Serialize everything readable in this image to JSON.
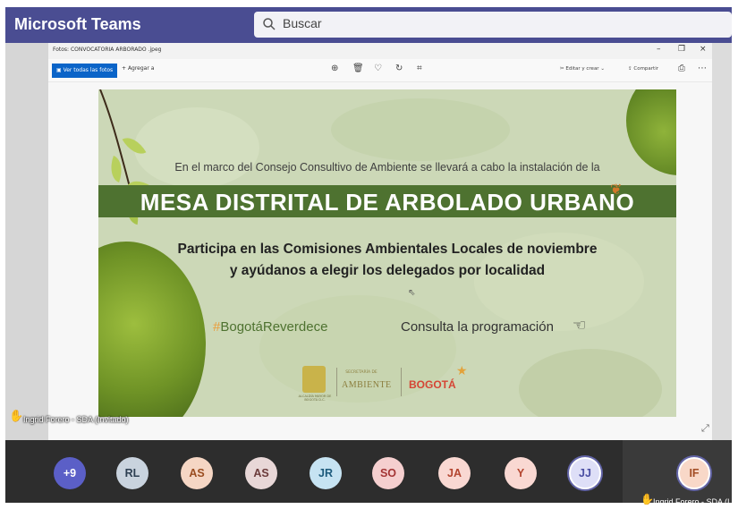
{
  "teams": {
    "app_title": "Microsoft Teams",
    "search_placeholder": "Buscar",
    "accent": "#4a4d92"
  },
  "photos_window": {
    "title": "Fotos: CONVOCATORIA ARBORADO .jpeg",
    "toolbar": {
      "all_photos": "Ver todas las fotos",
      "add_to": "Agregar a",
      "edit_create": "Editar y crear",
      "share": "Compartir"
    }
  },
  "banner": {
    "intro": "En el marco del Consejo Consultivo de Ambiente se llevará a cabo la instalación de la",
    "title": "MESA DISTRITAL DE ARBOLADO URBANO",
    "line1": "Participa en las Comisiones Ambientales Locales de noviembre",
    "line2": "y ayúdanos a elegir los delegados por localidad",
    "hashtag_symbol": "#",
    "hashtag": "BogotáReverdece",
    "consulta": "Consulta la programación",
    "secretaria": "SECRETARÍA DE",
    "ambiente": "AMBIENTE",
    "bogota": "BOGOTÁ",
    "seal_caption": "ALCALDÍA MAYOR DE BOGOTÁ D.C.",
    "brand_green": "#4e7230"
  },
  "presenter": {
    "name": "Ingrid Forero - SDA (Invitado)"
  },
  "participants": [
    {
      "initials": "+9",
      "bg": "#5b5fc7",
      "fg": "#ffffff"
    },
    {
      "initials": "RL",
      "bg": "#c9d3de",
      "fg": "#2d3f52"
    },
    {
      "initials": "AS",
      "bg": "#f5d6c4",
      "fg": "#9a4d20"
    },
    {
      "initials": "AS",
      "bg": "#e8d7d7",
      "fg": "#6b3b3b"
    },
    {
      "initials": "JR",
      "bg": "#c6e3f2",
      "fg": "#1d5b7c"
    },
    {
      "initials": "SO",
      "bg": "#f5cfcf",
      "fg": "#a33434"
    },
    {
      "initials": "JA",
      "bg": "#f9d8d2",
      "fg": "#b3452f"
    },
    {
      "initials": "Y",
      "bg": "#f9d8d2",
      "fg": "#b3452f"
    },
    {
      "initials": "JJ",
      "bg": "#dedff7",
      "fg": "#4b4fa3"
    }
  ],
  "self_participant": {
    "initials": "IF",
    "bg": "#f8d8c8",
    "fg": "#a24d24",
    "name": "Ingrid Forero - SDA (I"
  }
}
